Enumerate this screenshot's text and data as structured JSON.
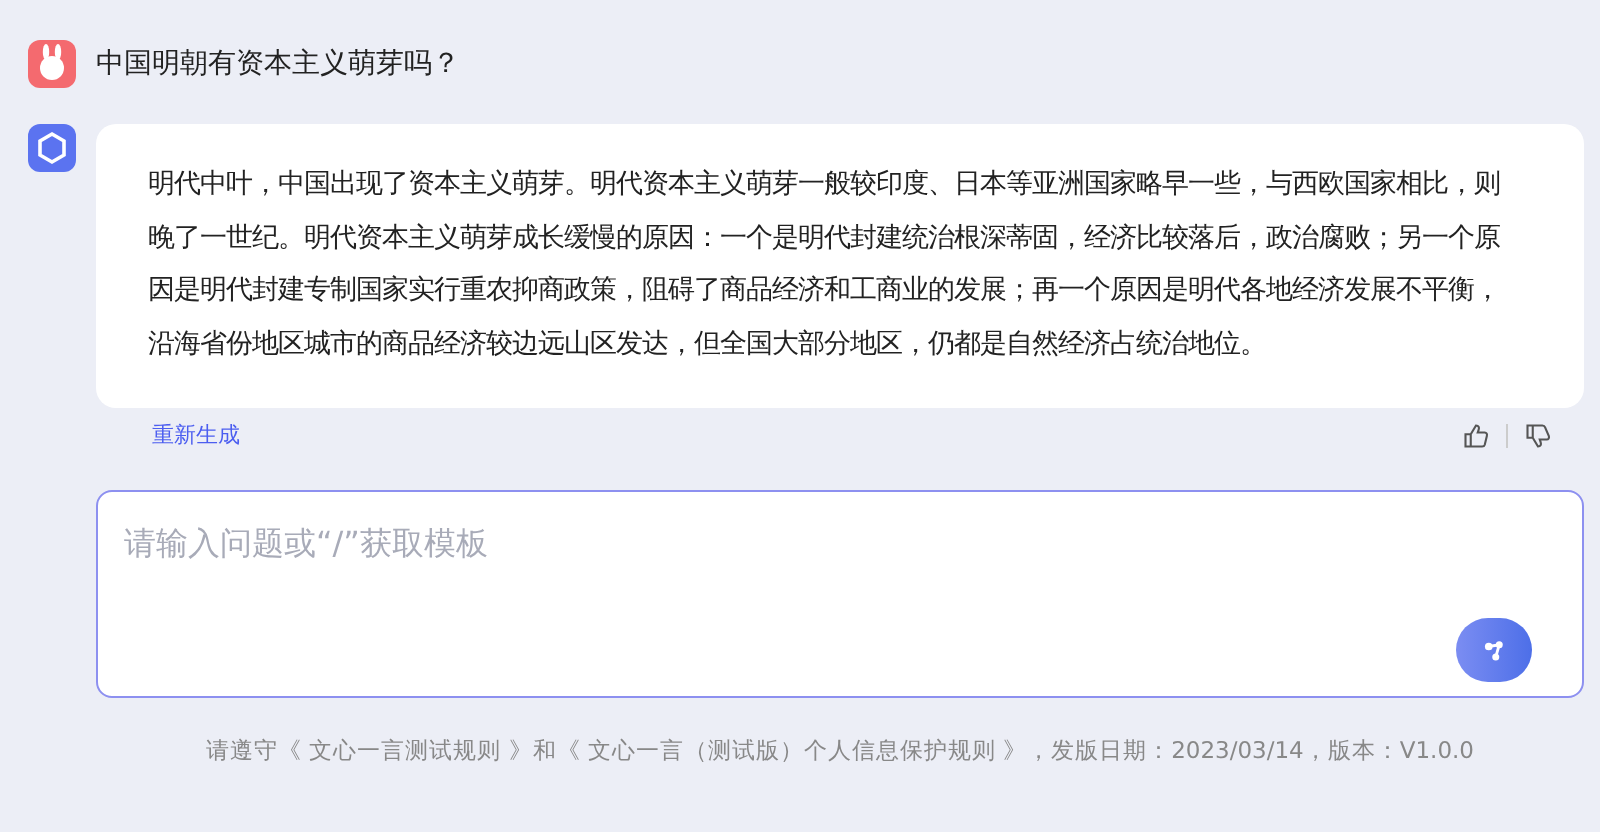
{
  "question": {
    "text": "中国明朝有资本主义萌芽吗？"
  },
  "answer": {
    "text": "明代中叶，中国出现了资本主义萌芽。明代资本主义萌芽一般较印度、日本等亚洲国家略早一些，与西欧国家相比，则晚了一世纪。明代资本主义萌芽成长缓慢的原因：一个是明代封建统治根深蒂固，经济比较落后，政治腐败；另一个原因是明代封建专制国家实行重农抑商政策，阻碍了商品经济和工商业的发展；再一个原因是明代各地经济发展不平衡，沿海省份地区城市的商品经济较边远山区发达，但全国大部分地区，仍都是自然经济占统治地位。",
    "regenerate": "重新生成"
  },
  "input": {
    "placeholder": "请输入问题或“/”获取模板"
  },
  "footer": "请遵守《 文心一言测试规则 》和《 文心一言（测试版）个人信息保护规则 》，发版日期：2023/03/14，版本：V1.0.0"
}
